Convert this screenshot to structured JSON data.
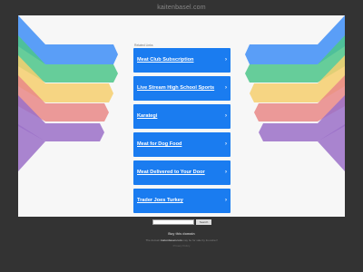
{
  "page": {
    "domain": "kaitenbasel.com"
  },
  "main": {
    "related_label": "Related Links",
    "links": [
      {
        "label": "Meat Club Subscription",
        "chevron": "›"
      },
      {
        "label": "Live Stream High School Sports",
        "chevron": "›"
      },
      {
        "label": "Karategi",
        "chevron": "›"
      },
      {
        "label": "Meat for Dog Food",
        "chevron": "›"
      },
      {
        "label": "Meat Delivered to Your Door",
        "chevron": "›"
      },
      {
        "label": "Trader Joes Turkey",
        "chevron": "›"
      }
    ]
  },
  "search": {
    "placeholder": "",
    "button_label": "Search"
  },
  "footer": {
    "buy_title": "Buy this domain",
    "buy_text_before": "The domain",
    "buy_domain": "kaitenbasel.com",
    "buy_text_after": "may be for sale by its owner!",
    "privacy": "Privacy Policy"
  },
  "colors": {
    "background": "#333333",
    "panel": "#f7f7f7",
    "link_button": "#1a7cf0",
    "ribbons": [
      "#3e8ef7",
      "#4cc68a",
      "#f6cf6e",
      "#e98887",
      "#9b70c8"
    ]
  }
}
